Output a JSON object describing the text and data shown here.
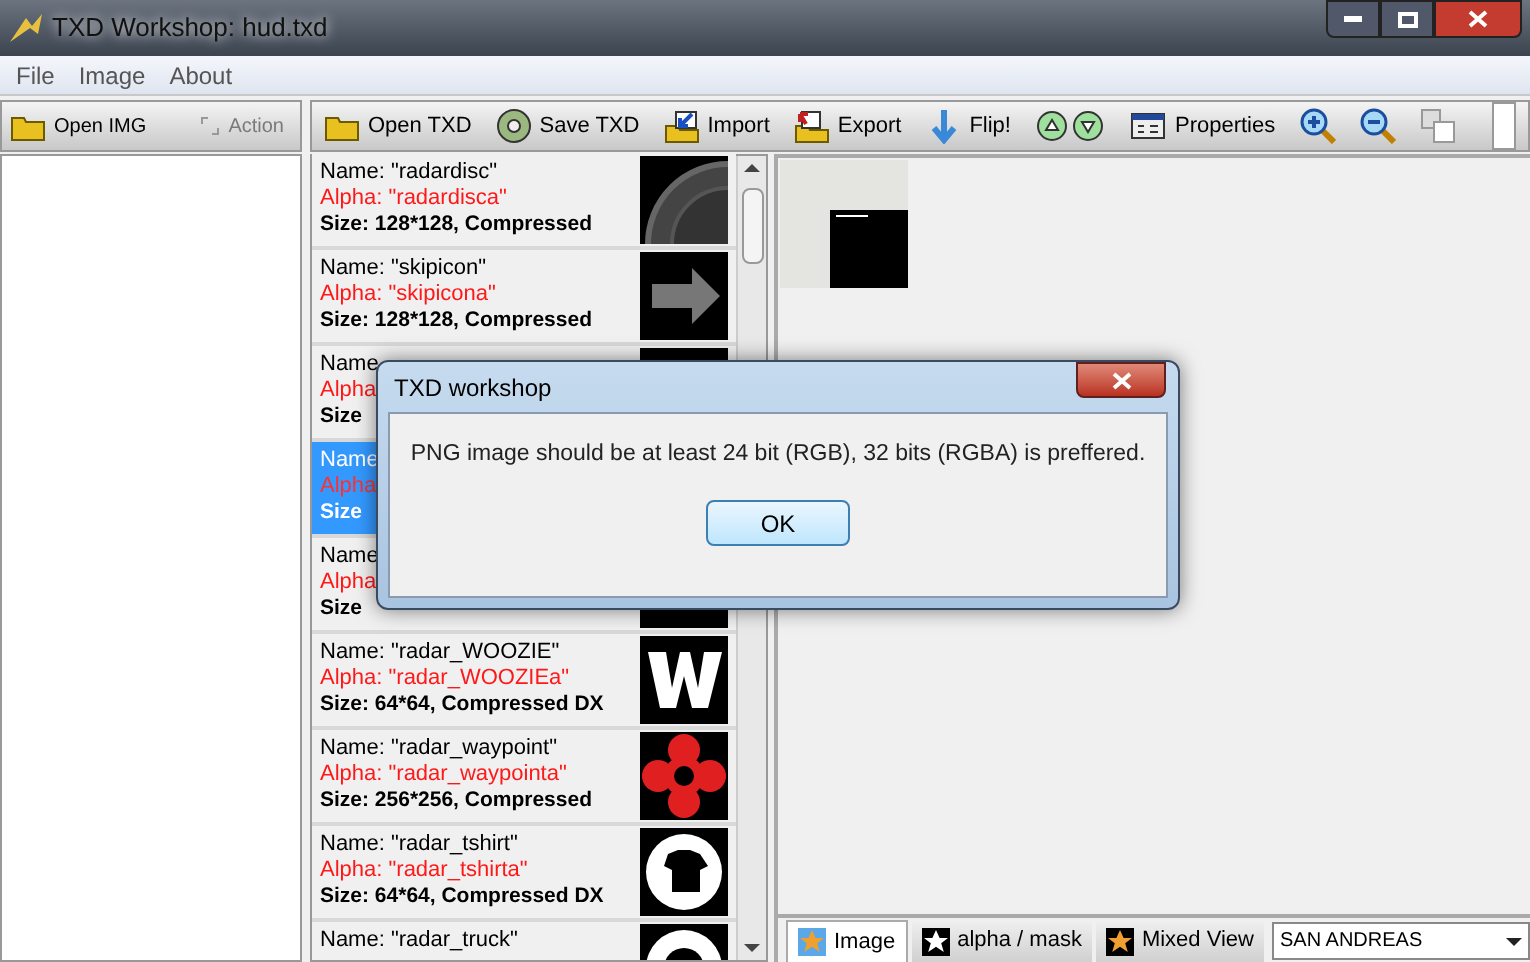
{
  "window": {
    "title": "TXD Workshop: hud.txd"
  },
  "menu": [
    "File",
    "Image",
    "About"
  ],
  "left_toolbar": [
    {
      "label": "Open IMG",
      "kind": "folder",
      "disabled": false
    },
    {
      "label": "Action",
      "kind": "action",
      "disabled": true
    }
  ],
  "toolbar": [
    {
      "label": "Open TXD",
      "kind": "folder"
    },
    {
      "label": "Save TXD",
      "kind": "disc"
    },
    {
      "label": "Import",
      "kind": "import"
    },
    {
      "label": "Export",
      "kind": "export"
    },
    {
      "label": "Flip!",
      "kind": "flip"
    },
    {
      "kind": "updown"
    },
    {
      "label": "Properties",
      "kind": "properties"
    },
    {
      "kind": "zoomin"
    },
    {
      "kind": "zoomout"
    },
    {
      "kind": "copy"
    }
  ],
  "textures": [
    {
      "name": "Name: \"radardisc\"",
      "alpha": "Alpha: \"radardisca\"",
      "size": "Size: 128*128, Compressed",
      "selected": false,
      "kind": "disc"
    },
    {
      "name": "Name: \"skipicon\"",
      "alpha": "Alpha: \"skipicona\"",
      "size": "Size: 128*128, Compressed",
      "selected": false,
      "kind": "arrow"
    },
    {
      "name": "Name",
      "alpha": "Alpha",
      "size": "Size",
      "selected": false,
      "kind": "dark"
    },
    {
      "name": "Name",
      "alpha": "Alpha",
      "size": "Size",
      "selected": true,
      "kind": "dark"
    },
    {
      "name": "Name",
      "alpha": "Alpha",
      "size": "Size",
      "selected": false,
      "kind": "dark"
    },
    {
      "name": "Name: \"radar_WOOZIE\"",
      "alpha": "Alpha: \"radar_WOOZIEa\"",
      "size": "Size: 64*64, Compressed DX",
      "selected": false,
      "kind": "w"
    },
    {
      "name": "Name: \"radar_waypoint\"",
      "alpha": "Alpha: \"radar_waypointa\"",
      "size": "Size: 256*256, Compressed",
      "selected": false,
      "kind": "waypoint"
    },
    {
      "name": "Name: \"radar_tshirt\"",
      "alpha": "Alpha: \"radar_tshirta\"",
      "size": "Size: 64*64, Compressed DX",
      "selected": false,
      "kind": "tshirt"
    },
    {
      "name": "Name: \"radar_truck\"",
      "selected": false,
      "kind": "circle"
    }
  ],
  "view_tabs": [
    {
      "label": "Image",
      "selected": true,
      "kind": "image"
    },
    {
      "label": "alpha / mask",
      "selected": false,
      "kind": "alpha"
    },
    {
      "label": "Mixed View",
      "selected": false,
      "kind": "mixed"
    }
  ],
  "game_select": {
    "value": "SAN ANDREAS"
  },
  "dialog": {
    "title": "TXD workshop",
    "message": "PNG image should be at least 24 bit (RGB), 32 bits (RGBA) is preffered.",
    "button": "OK"
  }
}
